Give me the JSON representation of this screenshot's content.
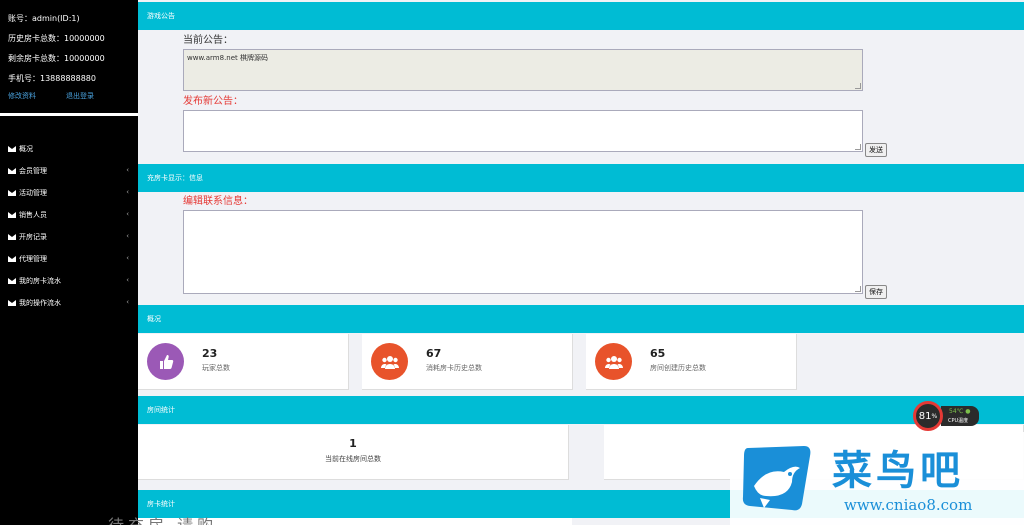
{
  "sidebar": {
    "account": "账号：admin(ID:1)",
    "history_cards": "历史房卡总数：10000000",
    "remaining_cards": "剩余房卡总数：10000000",
    "phone": "手机号：13888888880",
    "edit_link": "修改资料",
    "logout_link": "退出登录",
    "menu": [
      {
        "label": "概况"
      },
      {
        "label": "会员管理"
      },
      {
        "label": "活动管理"
      },
      {
        "label": "销售人员"
      },
      {
        "label": "开房记录"
      },
      {
        "label": "代理管理"
      },
      {
        "label": "我的房卡流水"
      },
      {
        "label": "我的操作流水"
      }
    ]
  },
  "announce": {
    "bar": "游戏公告",
    "current_label": "当前公告：",
    "current_text": "www.arm8.net 棋牌源码",
    "new_label": "发布新公告：",
    "send_button": "发送"
  },
  "contact": {
    "bar": "充房卡显示：信息",
    "edit_label": "编辑联系信息：",
    "save_button": "保存"
  },
  "overview": {
    "bar": "概况",
    "cards": [
      {
        "value": "23",
        "label": "玩家总数",
        "color": "#9b59b6",
        "icon": "thumbs-up-icon"
      },
      {
        "value": "67",
        "label": "消耗房卡历史总数",
        "color": "#e8532b",
        "icon": "users-icon"
      },
      {
        "value": "65",
        "label": "房间创建历史总数",
        "color": "#e8532b",
        "icon": "users-icon"
      }
    ]
  },
  "room_stats": {
    "bar": "房间统计",
    "value": "1",
    "label": "当前在线房间总数"
  },
  "card_stats": {
    "bar": "房卡统计"
  },
  "overlay": {
    "cpu_percent": "81",
    "cpu_unit": "%",
    "cpu_temp": "54℃",
    "cpu_label": "CPU温度",
    "logo_text": "菜鸟吧",
    "logo_url": "www.cniao8.com",
    "bottom_blur": "待充房 请购"
  }
}
